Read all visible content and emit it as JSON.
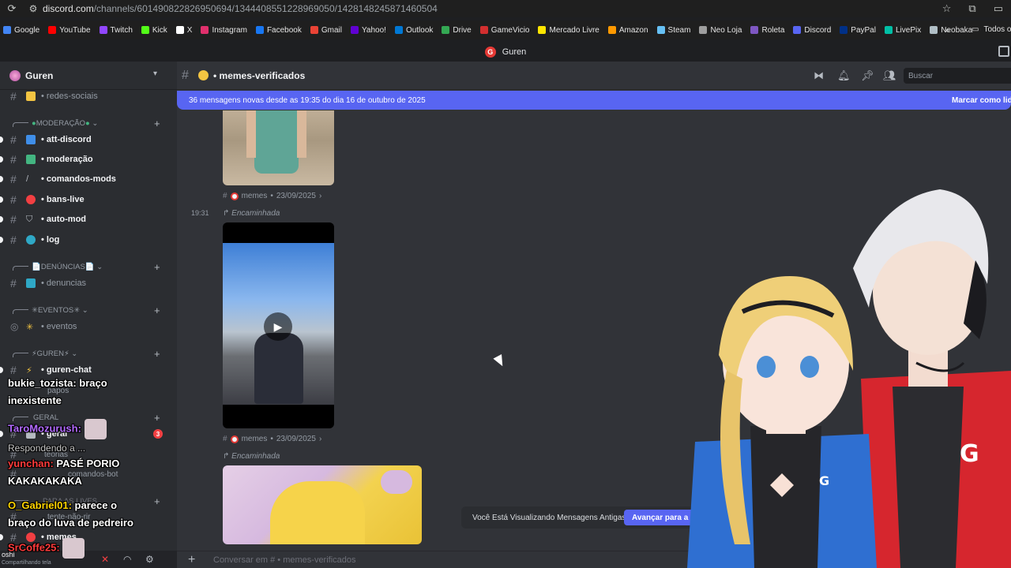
{
  "browser": {
    "url_main": "discord.com",
    "url_path": "/channels/601490822826950694/1344408551228969050/1428148245871460504",
    "bookmarks": [
      {
        "label": "Google",
        "color": "#4285f4"
      },
      {
        "label": "YouTube",
        "color": "#ff0000"
      },
      {
        "label": "Twitch",
        "color": "#9146ff"
      },
      {
        "label": "Kick",
        "color": "#53fc18"
      },
      {
        "label": "X",
        "color": "#ffffff"
      },
      {
        "label": "Instagram",
        "color": "#e1306c"
      },
      {
        "label": "Facebook",
        "color": "#1877f2"
      },
      {
        "label": "Gmail",
        "color": "#ea4335"
      },
      {
        "label": "Yahoo!",
        "color": "#6001d2"
      },
      {
        "label": "Outlook",
        "color": "#0078d4"
      },
      {
        "label": "Drive",
        "color": "#34a853"
      },
      {
        "label": "GameVicio",
        "color": "#d32f2f"
      },
      {
        "label": "Mercado Livre",
        "color": "#ffe600"
      },
      {
        "label": "Amazon",
        "color": "#ff9900"
      },
      {
        "label": "Steam",
        "color": "#66c0f4"
      },
      {
        "label": "Neo Loja",
        "color": "#9e9e9e"
      },
      {
        "label": "Roleta",
        "color": "#7e57c2"
      },
      {
        "label": "Discord",
        "color": "#5865f2"
      },
      {
        "label": "PayPal",
        "color": "#003087"
      },
      {
        "label": "LivePix",
        "color": "#00bfa5"
      },
      {
        "label": "Neobaka",
        "color": "#b0bec5"
      }
    ],
    "all_bookmarks_label": "Todos o"
  },
  "app": {
    "title": "Guren"
  },
  "sidebar": {
    "server_name": "Guren",
    "channels_top": [
      {
        "name": "• redes-sociais",
        "bright": false
      }
    ],
    "categories": [
      {
        "label": "MODERAÇÃO"
      },
      {
        "label": "DENÚNCIAS"
      },
      {
        "label": "EVENTOS"
      },
      {
        "label": "GUREN"
      },
      {
        "label": "GERAL"
      },
      {
        "label": "PARA AS LIVES"
      }
    ],
    "channels_mod": [
      {
        "name": "• att-discord",
        "color": "#3f8ee8"
      },
      {
        "name": "• moderação",
        "color": "#43b581"
      },
      {
        "name": "• comandos-mods",
        "color": "#b5bac1"
      },
      {
        "name": "• bans-live",
        "color": "#f23f42"
      },
      {
        "name": "• auto-mod",
        "color": "#b5bac1"
      },
      {
        "name": "• log",
        "color": "#2fa8c6"
      }
    ],
    "channel_denuncias": "• denuncias",
    "channel_eventos": "• eventos",
    "channel_guren_chat": "• guren-chat",
    "channel_papos": "papos",
    "channel_geral": "• geral",
    "geral_badge": "3",
    "channel_teorias": "teorias",
    "channel_comandos_bot": "comandos-bot",
    "channel_tente": "tente-não-rir",
    "channel_memes": "• memes",
    "user_label": "oshi",
    "user_status": "Compartilhando tela"
  },
  "stream_chat": [
    {
      "user": "bukie_tozista:",
      "user_color": "#ffffff",
      "text": " braço",
      "text2": "inexistente"
    },
    {
      "user": "TaroMozurush:",
      "user_color": "#b36bff",
      "text": ""
    },
    {
      "user": "Respondendo a ...",
      "user_color": "#c8c8c8",
      "text": ""
    },
    {
      "user": "yunchan:",
      "user_color": "#ff3b3b",
      "text": " PASÉ PORIO",
      "text2": "KAKAKAKAKA"
    },
    {
      "user": "O_Gabriel01:",
      "user_color": "#ffd400",
      "text": " parece o",
      "text2": "braço do luva de pedreiro"
    },
    {
      "user": "SrCoffe25:",
      "user_color": "#ff3b3b",
      "text": ""
    }
  ],
  "channel": {
    "name": "• memes-verificados",
    "search_placeholder": "Buscar",
    "new_messages": "36 mensagens novas desde as 19:35 do dia 16 de outubro de 2025",
    "mark_read": "Marcar como lida"
  },
  "messages": [
    {
      "source": "memes",
      "date": "23/09/2025"
    },
    {
      "time": "19:31",
      "forwarded_label": "Encaminhada",
      "source": "memes",
      "date": "23/09/2025"
    },
    {
      "forwarded_label": "Encaminhada"
    }
  ],
  "old_messages_notice": {
    "text": "Você Está Visualizando Mensagens Antigas",
    "jump_label": "Avançar para a"
  },
  "composer": {
    "placeholder": "Conversar em #  • memes-verificados"
  }
}
